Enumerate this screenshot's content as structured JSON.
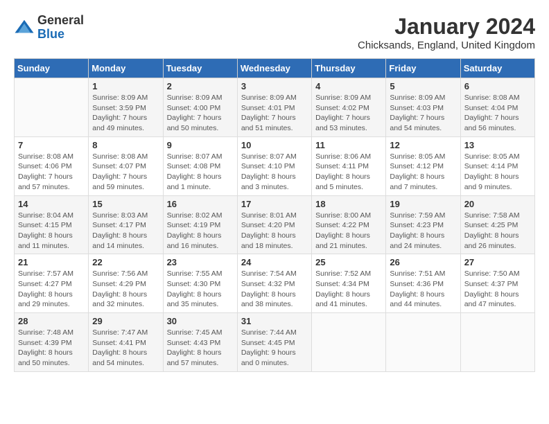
{
  "header": {
    "logo_general": "General",
    "logo_blue": "Blue",
    "month_title": "January 2024",
    "subtitle": "Chicksands, England, United Kingdom"
  },
  "days_of_week": [
    "Sunday",
    "Monday",
    "Tuesday",
    "Wednesday",
    "Thursday",
    "Friday",
    "Saturday"
  ],
  "weeks": [
    [
      {
        "day": "",
        "sunrise": "",
        "sunset": "",
        "daylight": ""
      },
      {
        "day": "1",
        "sunrise": "Sunrise: 8:09 AM",
        "sunset": "Sunset: 3:59 PM",
        "daylight": "Daylight: 7 hours and 49 minutes."
      },
      {
        "day": "2",
        "sunrise": "Sunrise: 8:09 AM",
        "sunset": "Sunset: 4:00 PM",
        "daylight": "Daylight: 7 hours and 50 minutes."
      },
      {
        "day": "3",
        "sunrise": "Sunrise: 8:09 AM",
        "sunset": "Sunset: 4:01 PM",
        "daylight": "Daylight: 7 hours and 51 minutes."
      },
      {
        "day": "4",
        "sunrise": "Sunrise: 8:09 AM",
        "sunset": "Sunset: 4:02 PM",
        "daylight": "Daylight: 7 hours and 53 minutes."
      },
      {
        "day": "5",
        "sunrise": "Sunrise: 8:09 AM",
        "sunset": "Sunset: 4:03 PM",
        "daylight": "Daylight: 7 hours and 54 minutes."
      },
      {
        "day": "6",
        "sunrise": "Sunrise: 8:08 AM",
        "sunset": "Sunset: 4:04 PM",
        "daylight": "Daylight: 7 hours and 56 minutes."
      }
    ],
    [
      {
        "day": "7",
        "sunrise": "Sunrise: 8:08 AM",
        "sunset": "Sunset: 4:06 PM",
        "daylight": "Daylight: 7 hours and 57 minutes."
      },
      {
        "day": "8",
        "sunrise": "Sunrise: 8:08 AM",
        "sunset": "Sunset: 4:07 PM",
        "daylight": "Daylight: 7 hours and 59 minutes."
      },
      {
        "day": "9",
        "sunrise": "Sunrise: 8:07 AM",
        "sunset": "Sunset: 4:08 PM",
        "daylight": "Daylight: 8 hours and 1 minute."
      },
      {
        "day": "10",
        "sunrise": "Sunrise: 8:07 AM",
        "sunset": "Sunset: 4:10 PM",
        "daylight": "Daylight: 8 hours and 3 minutes."
      },
      {
        "day": "11",
        "sunrise": "Sunrise: 8:06 AM",
        "sunset": "Sunset: 4:11 PM",
        "daylight": "Daylight: 8 hours and 5 minutes."
      },
      {
        "day": "12",
        "sunrise": "Sunrise: 8:05 AM",
        "sunset": "Sunset: 4:12 PM",
        "daylight": "Daylight: 8 hours and 7 minutes."
      },
      {
        "day": "13",
        "sunrise": "Sunrise: 8:05 AM",
        "sunset": "Sunset: 4:14 PM",
        "daylight": "Daylight: 8 hours and 9 minutes."
      }
    ],
    [
      {
        "day": "14",
        "sunrise": "Sunrise: 8:04 AM",
        "sunset": "Sunset: 4:15 PM",
        "daylight": "Daylight: 8 hours and 11 minutes."
      },
      {
        "day": "15",
        "sunrise": "Sunrise: 8:03 AM",
        "sunset": "Sunset: 4:17 PM",
        "daylight": "Daylight: 8 hours and 14 minutes."
      },
      {
        "day": "16",
        "sunrise": "Sunrise: 8:02 AM",
        "sunset": "Sunset: 4:19 PM",
        "daylight": "Daylight: 8 hours and 16 minutes."
      },
      {
        "day": "17",
        "sunrise": "Sunrise: 8:01 AM",
        "sunset": "Sunset: 4:20 PM",
        "daylight": "Daylight: 8 hours and 18 minutes."
      },
      {
        "day": "18",
        "sunrise": "Sunrise: 8:00 AM",
        "sunset": "Sunset: 4:22 PM",
        "daylight": "Daylight: 8 hours and 21 minutes."
      },
      {
        "day": "19",
        "sunrise": "Sunrise: 7:59 AM",
        "sunset": "Sunset: 4:23 PM",
        "daylight": "Daylight: 8 hours and 24 minutes."
      },
      {
        "day": "20",
        "sunrise": "Sunrise: 7:58 AM",
        "sunset": "Sunset: 4:25 PM",
        "daylight": "Daylight: 8 hours and 26 minutes."
      }
    ],
    [
      {
        "day": "21",
        "sunrise": "Sunrise: 7:57 AM",
        "sunset": "Sunset: 4:27 PM",
        "daylight": "Daylight: 8 hours and 29 minutes."
      },
      {
        "day": "22",
        "sunrise": "Sunrise: 7:56 AM",
        "sunset": "Sunset: 4:29 PM",
        "daylight": "Daylight: 8 hours and 32 minutes."
      },
      {
        "day": "23",
        "sunrise": "Sunrise: 7:55 AM",
        "sunset": "Sunset: 4:30 PM",
        "daylight": "Daylight: 8 hours and 35 minutes."
      },
      {
        "day": "24",
        "sunrise": "Sunrise: 7:54 AM",
        "sunset": "Sunset: 4:32 PM",
        "daylight": "Daylight: 8 hours and 38 minutes."
      },
      {
        "day": "25",
        "sunrise": "Sunrise: 7:52 AM",
        "sunset": "Sunset: 4:34 PM",
        "daylight": "Daylight: 8 hours and 41 minutes."
      },
      {
        "day": "26",
        "sunrise": "Sunrise: 7:51 AM",
        "sunset": "Sunset: 4:36 PM",
        "daylight": "Daylight: 8 hours and 44 minutes."
      },
      {
        "day": "27",
        "sunrise": "Sunrise: 7:50 AM",
        "sunset": "Sunset: 4:37 PM",
        "daylight": "Daylight: 8 hours and 47 minutes."
      }
    ],
    [
      {
        "day": "28",
        "sunrise": "Sunrise: 7:48 AM",
        "sunset": "Sunset: 4:39 PM",
        "daylight": "Daylight: 8 hours and 50 minutes."
      },
      {
        "day": "29",
        "sunrise": "Sunrise: 7:47 AM",
        "sunset": "Sunset: 4:41 PM",
        "daylight": "Daylight: 8 hours and 54 minutes."
      },
      {
        "day": "30",
        "sunrise": "Sunrise: 7:45 AM",
        "sunset": "Sunset: 4:43 PM",
        "daylight": "Daylight: 8 hours and 57 minutes."
      },
      {
        "day": "31",
        "sunrise": "Sunrise: 7:44 AM",
        "sunset": "Sunset: 4:45 PM",
        "daylight": "Daylight: 9 hours and 0 minutes."
      },
      {
        "day": "",
        "sunrise": "",
        "sunset": "",
        "daylight": ""
      },
      {
        "day": "",
        "sunrise": "",
        "sunset": "",
        "daylight": ""
      },
      {
        "day": "",
        "sunrise": "",
        "sunset": "",
        "daylight": ""
      }
    ]
  ]
}
